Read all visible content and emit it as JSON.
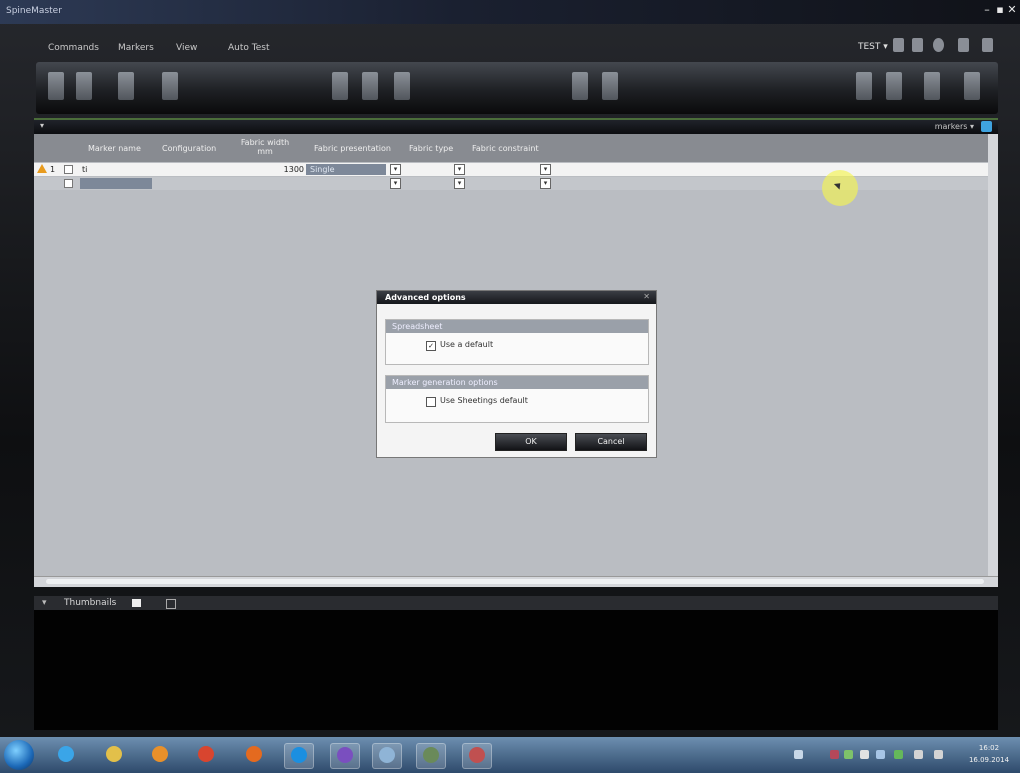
{
  "window": {
    "title": "SpineMaster",
    "controls": [
      "–",
      "▪",
      "✕"
    ]
  },
  "menu": {
    "items": [
      "Commands",
      "Markers",
      "View",
      "Auto Test"
    ],
    "user": "TEST ▾"
  },
  "toolbar": {
    "groups": [
      "file",
      "edit",
      "view",
      "tools",
      "report"
    ]
  },
  "strip": {
    "arrow": "▾",
    "markers_label": "markers ▾"
  },
  "grid": {
    "columns": [
      "Marker name",
      "Configuration",
      "Fabric width mm",
      "Fabric presentation",
      "Fabric type",
      "Fabric constraint"
    ],
    "rows": [
      {
        "index": "1",
        "name": "ti",
        "width": "1300",
        "presentation": "Single",
        "has_warning": true,
        "has_check": true
      },
      {
        "index": "",
        "name": "",
        "width": "",
        "presentation": "",
        "has_warning": false,
        "has_check": true
      }
    ]
  },
  "dialog": {
    "title": "Advanced options",
    "close": "✕",
    "group1": {
      "header": "Spreadsheet",
      "option_label": "Use a default",
      "checked": true
    },
    "group2": {
      "header": "Marker generation options",
      "option_label": "Use Sheetings default",
      "checked": false
    },
    "ok_label": "OK",
    "cancel_label": "Cancel"
  },
  "thumbnails": {
    "label": "Thumbnails"
  },
  "taskbar": {
    "apps": [
      {
        "name": "start",
        "color": "#2a7dd4"
      },
      {
        "name": "ie",
        "color": "#3aa5e8"
      },
      {
        "name": "explorer",
        "color": "#e2c04a"
      },
      {
        "name": "media",
        "color": "#e8902a"
      },
      {
        "name": "chrome",
        "color": "#d8452f"
      },
      {
        "name": "firefox",
        "color": "#e46a1f"
      },
      {
        "name": "skype",
        "color": "#1b8fe0"
      },
      {
        "name": "viber",
        "color": "#7a4fbf"
      },
      {
        "name": "monitor",
        "color": "#8fb4d6"
      },
      {
        "name": "spreadsheet",
        "color": "#6a8a5a"
      },
      {
        "name": "paint",
        "color": "#c05050"
      }
    ],
    "clock_time": "16:02",
    "clock_date": "16.09.2014"
  }
}
